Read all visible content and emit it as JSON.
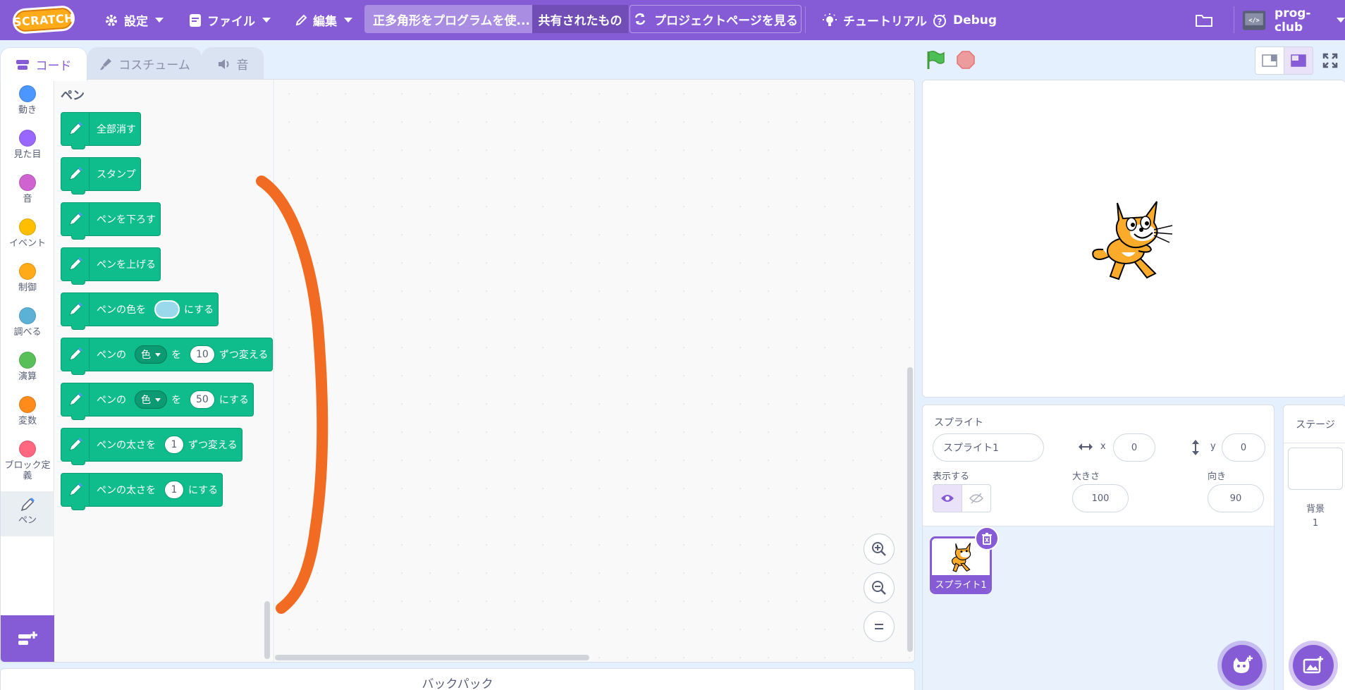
{
  "menubar": {
    "logo": "SCRATCH",
    "settings": "設定",
    "file": "ファイル",
    "edit": "編集",
    "project_title": "正多角形をプログラムを使...",
    "shared": "共有されたもの",
    "project_page": "プロジェクトページを見る",
    "tutorials": "チュートリアル",
    "debug": "Debug",
    "username": "prog-club"
  },
  "tabs": {
    "code": "コード",
    "costumes": "コスチューム",
    "sounds": "音"
  },
  "categories": [
    {
      "label": "動き",
      "color": "#4c97ff"
    },
    {
      "label": "見た目",
      "color": "#9966ff"
    },
    {
      "label": "音",
      "color": "#cf63cf"
    },
    {
      "label": "イベント",
      "color": "#ffbf00"
    },
    {
      "label": "制御",
      "color": "#ffab19"
    },
    {
      "label": "調べる",
      "color": "#5cb1d6"
    },
    {
      "label": "演算",
      "color": "#59c059"
    },
    {
      "label": "変数",
      "color": "#ff8c1a"
    },
    {
      "label": "ブロック定義",
      "color": "#ff6680"
    },
    {
      "label": "ペン",
      "color": "#0fbd8c"
    }
  ],
  "palette": {
    "title": "ペン",
    "blocks": {
      "clear": "全部消す",
      "stamp": "スタンプ",
      "pen_down": "ペンを下ろす",
      "pen_up": "ペンを上げる",
      "set_color_pre": "ペンの色を",
      "set_color_post": "にする",
      "change_param_pre": "ペンの",
      "change_param_drop": "色",
      "change_param_mid": "を",
      "change_param_value": "10",
      "change_param_post": "ずつ変える",
      "set_param_pre": "ペンの",
      "set_param_drop": "色",
      "set_param_mid": "を",
      "set_param_value": "50",
      "set_param_post": "にする",
      "change_size_pre": "ペンの太さを",
      "change_size_value": "1",
      "change_size_post": "ずつ変える",
      "set_size_pre": "ペンの太さを",
      "set_size_value": "1",
      "set_size_post": "にする"
    }
  },
  "backpack": "バックパック",
  "sprite_info": {
    "sprite_label": "スプライト",
    "sprite_name": "スプライト1",
    "x_label": "x",
    "x_value": "0",
    "y_label": "y",
    "y_value": "0",
    "show_label": "表示する",
    "size_label": "大きさ",
    "size_value": "100",
    "direction_label": "向き",
    "direction_value": "90"
  },
  "sprite_tile_name": "スプライト1",
  "stage_pane": {
    "title": "ステージ",
    "backdrops_label": "背景",
    "backdrops_count": "1"
  },
  "colors": {
    "menubar": "#855cd6",
    "pen_block": "#0fbd8c",
    "annotation_stroke": "#f26b23"
  }
}
